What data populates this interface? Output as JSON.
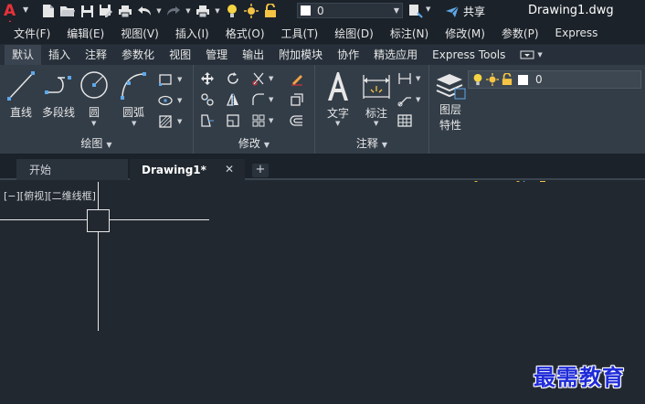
{
  "titlebar": {
    "layer_value": "0",
    "share_label": "共享",
    "doc_title": "Drawing1.dwg"
  },
  "menubar": {
    "items": [
      "文件(F)",
      "编辑(E)",
      "视图(V)",
      "插入(I)",
      "格式(O)",
      "工具(T)",
      "绘图(D)",
      "标注(N)",
      "修改(M)",
      "参数(P)",
      "Express"
    ]
  },
  "ribbon_tabs": [
    "默认",
    "插入",
    "注释",
    "参数化",
    "视图",
    "管理",
    "输出",
    "附加模块",
    "协作",
    "精选应用",
    "Express Tools"
  ],
  "ribbon": {
    "draw": {
      "title": "绘图",
      "line": "直线",
      "polyline": "多段线",
      "circle": "圆",
      "arc": "圆弧"
    },
    "modify": {
      "title": "修改"
    },
    "annotation": {
      "title": "注释",
      "text": "文字",
      "dimension": "标注"
    },
    "layers": {
      "title": "图层",
      "layer_props_1": "图层",
      "layer_props_2": "特性",
      "layer_value": "0"
    }
  },
  "doctabs": {
    "start": "开始",
    "drawing": "Drawing1*",
    "close": "✕",
    "new": "+"
  },
  "canvas": {
    "viewport_control": "[−][俯视][二维线框]"
  },
  "watermark": "最需教育",
  "colors": {
    "accent_red": "#e8313a",
    "background": "#212830",
    "ribbon": "#333d48",
    "watermark_blue": "#1f2bd8"
  }
}
